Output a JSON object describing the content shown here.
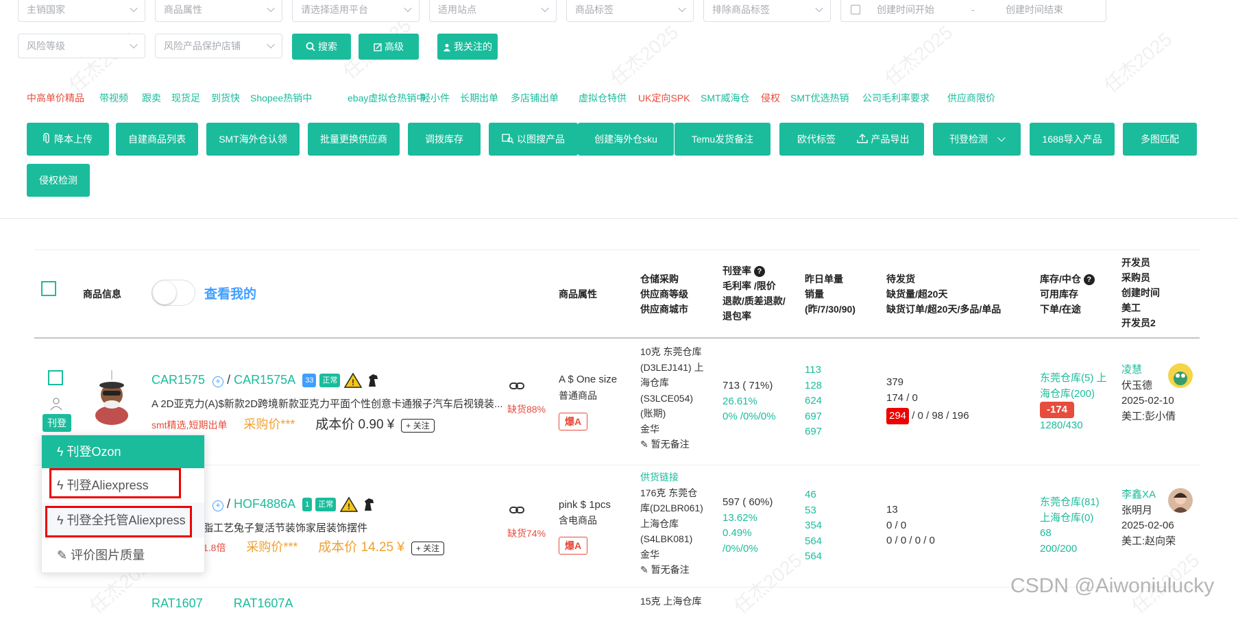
{
  "filters_row1": {
    "main_country": "主销国家",
    "product_attr": "商品属性",
    "platform": "请选择适用平台",
    "site": "适用站点",
    "product_tag": "商品标签",
    "exclude_tag": "排除商品标签",
    "created_start": "创建时间开始",
    "date_sep": "-",
    "created_end": "创建时间结束"
  },
  "filters_row2": {
    "risk_level": "风险等级",
    "risk_store": "风险产品保护店铺",
    "search_btn": "搜索",
    "advanced_btn": "高级",
    "follow_btn": "我关注的"
  },
  "quick_tags": [
    {
      "label": "中高单价精品",
      "color": "red"
    },
    {
      "label": "带视频",
      "color": "green"
    },
    {
      "label": "跟卖",
      "color": "green"
    },
    {
      "label": "现货足",
      "color": "green"
    },
    {
      "label": "到货快",
      "color": "green"
    },
    {
      "label": "Shopee热销中",
      "color": "green"
    },
    {
      "label": "ebay虚拟仓热销中",
      "color": "green"
    },
    {
      "label": "轻小件",
      "color": "green"
    },
    {
      "label": "长期出单",
      "color": "green"
    },
    {
      "label": "多店铺出单",
      "color": "green"
    },
    {
      "label": "虚拟仓特供",
      "color": "green"
    },
    {
      "label": "UK定向SPK",
      "color": "red"
    },
    {
      "label": "SMT威海仓",
      "color": "green"
    },
    {
      "label": "侵权",
      "color": "red"
    },
    {
      "label": "SMT优选热销",
      "color": "green"
    },
    {
      "label": "公司毛利率要求",
      "color": "green"
    },
    {
      "label": "供应商限价",
      "color": "green"
    }
  ],
  "actions": {
    "b1": "降本上传",
    "b2": "自建商品列表",
    "b3": "SMT海外仓认领",
    "b4": "批量更换供应商",
    "b5": "调拨库存",
    "b6": "以图搜产品",
    "b7": "创建海外仓sku",
    "b8": "Temu发货备注",
    "b9": "欧代标签",
    "b10": "产品导出",
    "b11": "刊登检测",
    "b12": "1688导入产品",
    "b13": "多图匹配",
    "b14": "侵权检测"
  },
  "table_header": {
    "product_info": "商品信息",
    "view_mine": "查看我的",
    "product_attr": "商品属性",
    "warehouse": [
      "仓储采购",
      "供应商等级",
      "供应商城市"
    ],
    "publish": [
      "刊登率",
      "毛利率 /限价",
      "退款/质差退款/",
      "退包率"
    ],
    "sales": [
      "昨日单量",
      "销量",
      "(昨/7/30/90)"
    ],
    "pending": [
      "待发货",
      "缺货量/超20天",
      "缺货订单/超20天/多品/单品"
    ],
    "stock": [
      "库存/中仓",
      "可用库存",
      "下单/在途"
    ],
    "dev": [
      "开发员",
      "采购员",
      "创建时间",
      "美工",
      "开发员2"
    ]
  },
  "rows": [
    {
      "sku": "CAR1575",
      "sku2": "CAR1575A",
      "count": "33",
      "status": "正常",
      "title": "A 2D亚克力(A)$新款2D跨境新款亚克力平面个性创意卡通猴子汽车后视镜装...",
      "tags": "smt精选,短期出单",
      "purchase_price": "采购价***",
      "cost_label": "成本价 0.90 ¥",
      "follow": "关注",
      "publish_btn": "刊登",
      "shortage": "缺货88%",
      "attr1": "A $ One size",
      "attr2": "普通商品",
      "hot": "爆A",
      "wh": [
        "10克  东莞仓库",
        "(D3LEJ141) 上",
        "海仓库",
        "(S3LCE054)",
        "(账期)",
        "金华"
      ],
      "note": "暂无备注",
      "rate": [
        "713 ( 71%)",
        "26.61%",
        "0% /0%/0%"
      ],
      "sales": [
        "113",
        "128",
        "624",
        "697",
        "697"
      ],
      "pend": [
        "379",
        "174 / 0"
      ],
      "pend_red": "294",
      "pend_rest": "/ 0 / 98 / 196",
      "stock": [
        "东莞仓库(5) 上",
        "海仓库(200)"
      ],
      "stock_red": "-174",
      "stock_last": "1280/430",
      "dev": [
        "凌慧",
        "伏玉德",
        "2025-02-10",
        "美工:彭小倩"
      ]
    },
    {
      "sku": "HOF4886A",
      "count": "1",
      "status": "正常",
      "title": "脂工艺兔子复活节装饰家居装饰摆件",
      "tags": "1.8倍",
      "purchase_price": "采购价***",
      "cost_label": "成本价 14.25 ¥",
      "follow": "关注",
      "shortage": "缺货74%",
      "attr1": "pink $ 1pcs",
      "attr2": "含电商品",
      "hot": "爆A",
      "supply_link": "供货链接",
      "wh": [
        "176克  东莞仓",
        "库(D2LBR061)",
        "上海仓库",
        "(S4LBK081)",
        "金华"
      ],
      "note": "暂无备注",
      "rate": [
        "597 ( 60%)",
        "13.62%",
        "0.49%",
        "/0%/0%"
      ],
      "sales": [
        "46",
        "53",
        "354",
        "564",
        "564"
      ],
      "pend": [
        "13",
        "0 / 0",
        "0 / 0 / 0 / 0"
      ],
      "stock": [
        "东莞仓库(81)",
        "上海仓库(0)",
        "68",
        "200/200"
      ],
      "dev": [
        "李鑫XA",
        "张明月",
        "2025-02-06",
        "美工:赵向荣"
      ]
    },
    {
      "sku": "RAT1607",
      "sku2": "RAT1607A",
      "wh_first": "15克  上海仓库"
    }
  ],
  "dropdown": {
    "ozon": "刊登Ozon",
    "aliexpress": "刊登Aliexpress",
    "full_ali": "刊登全托管Aliexpress",
    "rate_img": "评价图片质量"
  },
  "watermark": "CSDN @Aiwoniulucky",
  "wm_text": "任杰2025",
  "colors": {
    "accent": "#1abc9c",
    "danger": "#e74c3c",
    "orange": "#f0a030"
  }
}
